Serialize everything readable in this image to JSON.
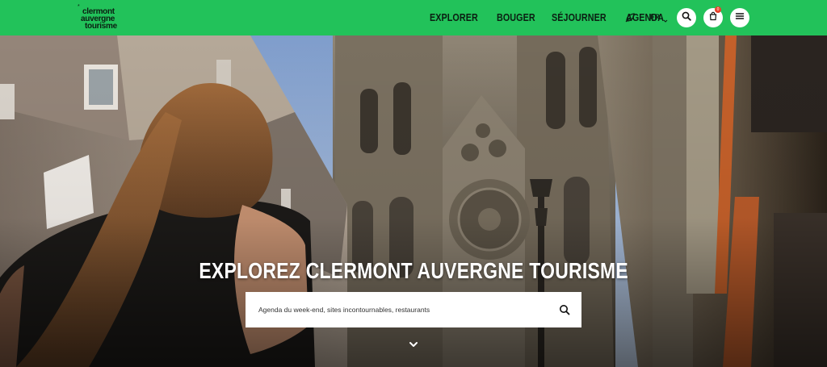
{
  "brand": {
    "logo_star": "*",
    "logo_lines": [
      "clermont",
      "auvergne",
      "tourisme"
    ]
  },
  "header": {
    "nav": [
      {
        "label": "EXPLORER"
      },
      {
        "label": "BOUGER"
      },
      {
        "label": "SÉJOURNER"
      },
      {
        "label": "AGENDA"
      }
    ],
    "eco_icon": "leaf-icon",
    "language": {
      "selected": "FR",
      "icon": "chevron-down-icon"
    },
    "search_icon": "search-icon",
    "cart": {
      "icon": "cart-icon",
      "badge": "0"
    },
    "menu_icon": "hamburger-icon"
  },
  "hero": {
    "title": "EXPLOREZ CLERMONT AUVERGNE TOURISME",
    "search": {
      "placeholder": "Agenda du week-end, sites incontournables, restaurants",
      "value": "",
      "icon": "search-icon"
    },
    "scroll_icon": "chevron-down-icon"
  },
  "colors": {
    "header_bg": "#22c25a",
    "header_text": "#0b1f12",
    "badge": "#e8412c"
  }
}
